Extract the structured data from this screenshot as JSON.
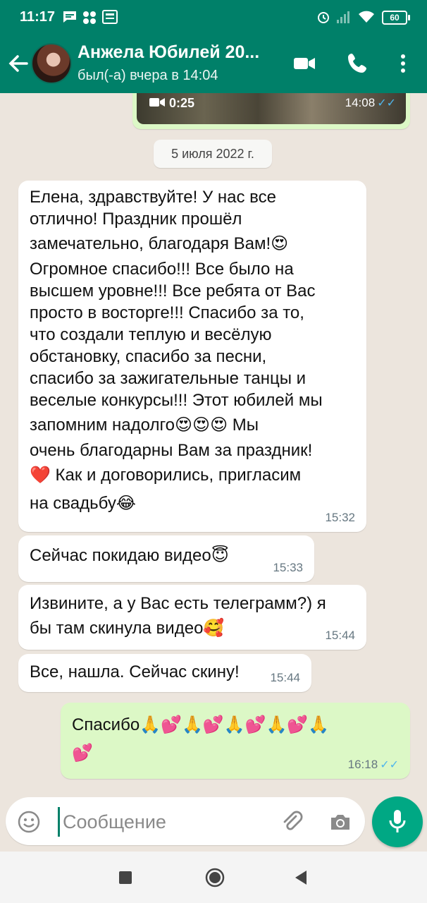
{
  "status_bar": {
    "time": "11:17",
    "battery": "60"
  },
  "header": {
    "title": "Анжела Юбилей 20...",
    "subtitle": "был(-а) вчера в 14:04"
  },
  "video_message": {
    "duration": "0:25",
    "time": "14:08"
  },
  "date_divider": "5 июля 2022 г.",
  "messages": [
    {
      "direction": "in",
      "lines": [
        "Елена, здравствуйте! У нас все",
        "отлично! Праздник прошёл",
        "замечательно, благодаря Вам!😍",
        "Огромное спасибо!!! Все было на",
        "высшем уровне!!! Все ребята от Вас",
        "просто в восторге!!! Спасибо за то,",
        "что создали теплую и весёлую",
        "обстановку, спасибо за песни,",
        "спасибо за зажигательные танцы и",
        "веселые конкурсы!!! Этот юбилей мы",
        "запомним надолго😍😍😍 Мы",
        "очень благодарны Вам за праздник!",
        "❤️ Как и договорились, пригласим",
        "на свадьбу😂"
      ],
      "time": "15:32"
    },
    {
      "direction": "in",
      "text": "Сейчас покидаю видео😇",
      "time": "15:33"
    },
    {
      "direction": "in",
      "lines": [
        "Извините, а у Вас есть телеграмм?) я",
        "бы там скинула видео🥰"
      ],
      "time": "15:44"
    },
    {
      "direction": "in",
      "text": "Все, нашла. Сейчас скину!",
      "time": "15:44"
    },
    {
      "direction": "out",
      "lines": [
        "Спасибо🙏💕🙏💕🙏💕🙏💕🙏",
        "💕"
      ],
      "time": "16:18",
      "ticks": "✓✓"
    }
  ],
  "composer": {
    "placeholder": "Сообщение"
  },
  "icons": {
    "back": "arrow-left-icon",
    "video_call": "video-camera-icon",
    "call": "phone-icon",
    "menu": "kebab-menu-icon",
    "emoji": "emoji-icon",
    "attach": "paperclip-icon",
    "camera": "camera-icon",
    "mic": "microphone-icon"
  },
  "colors": {
    "header": "#008069",
    "outgoing_bubble": "#dcf8c6",
    "incoming_bubble": "#ffffff",
    "chat_bg": "#ece5dd",
    "accent": "#00a884",
    "read_ticks": "#4fb6ec"
  }
}
